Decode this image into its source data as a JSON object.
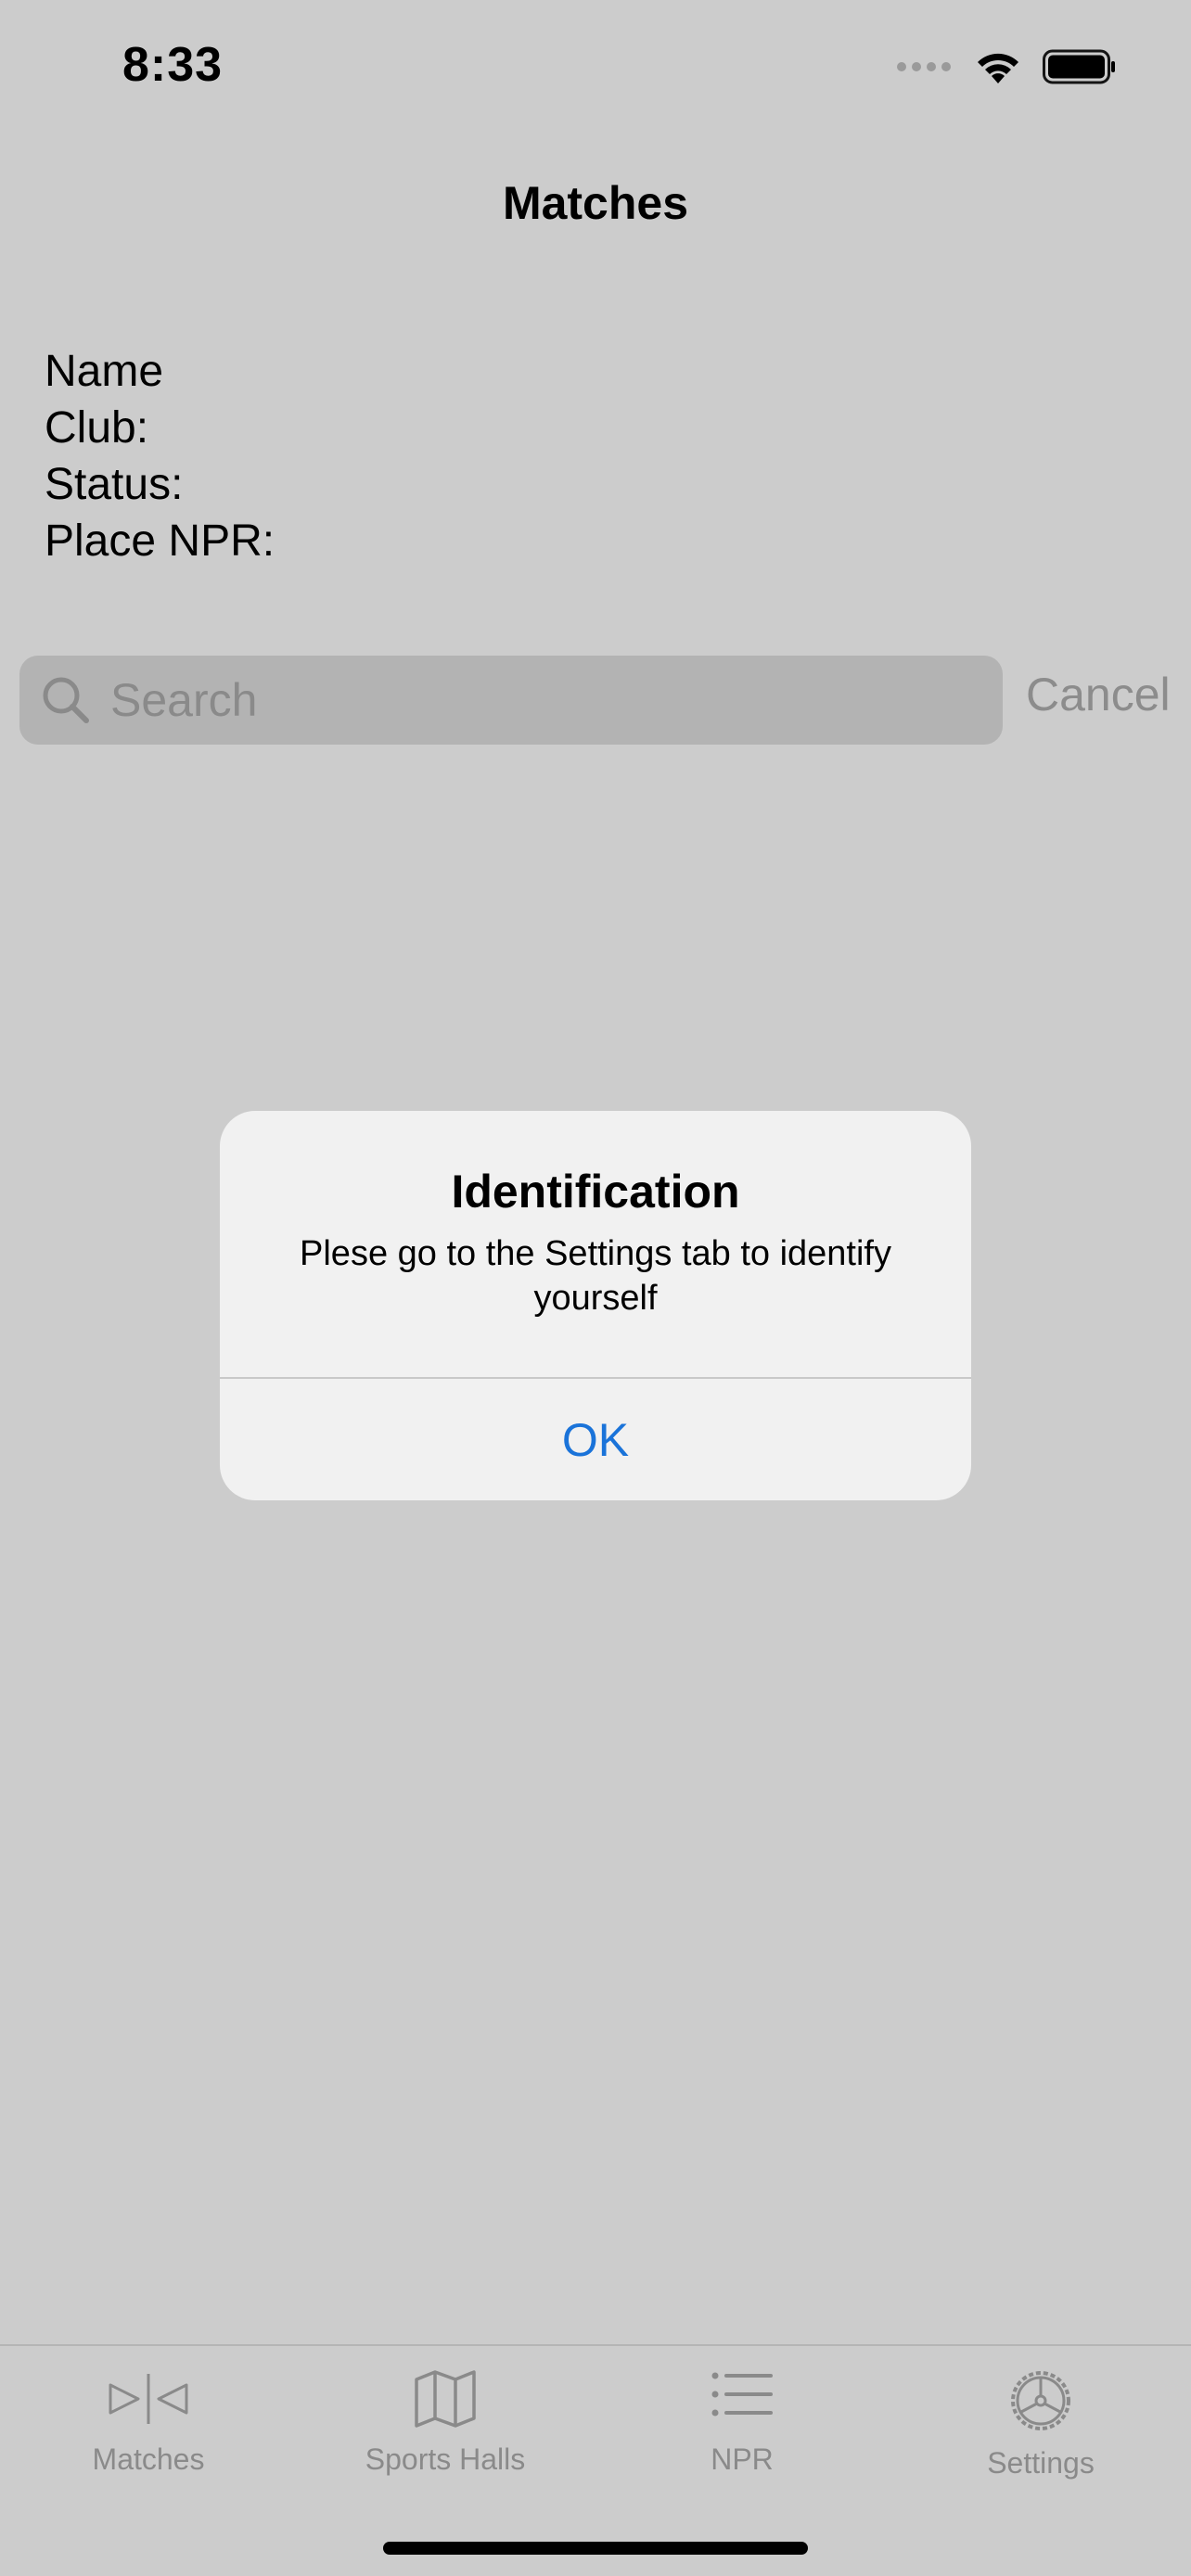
{
  "status_bar": {
    "time": "8:33",
    "icons": [
      "cellular-signal-icon",
      "wifi-icon",
      "battery-icon"
    ]
  },
  "nav": {
    "title": "Matches"
  },
  "profile": {
    "name_label": "Name",
    "club_label": "Club:",
    "status_label": "Status:",
    "place_npr_label": "Place NPR:"
  },
  "search": {
    "placeholder": "Search",
    "cancel_label": "Cancel"
  },
  "alert": {
    "title": "Identification",
    "message": "Plese go to the Settings tab to identify yourself",
    "ok_label": "OK"
  },
  "tabbar": {
    "tabs": [
      {
        "label": "Matches",
        "icon": "matches-icon"
      },
      {
        "label": "Sports Halls",
        "icon": "map-icon"
      },
      {
        "label": "NPR",
        "icon": "list-icon"
      },
      {
        "label": "Settings",
        "icon": "gear-icon"
      }
    ]
  },
  "colors": {
    "background": "#cccccc",
    "alert_background": "#f1f1f1",
    "accent": "#1a73d9",
    "inactive": "#8a8a8a"
  }
}
